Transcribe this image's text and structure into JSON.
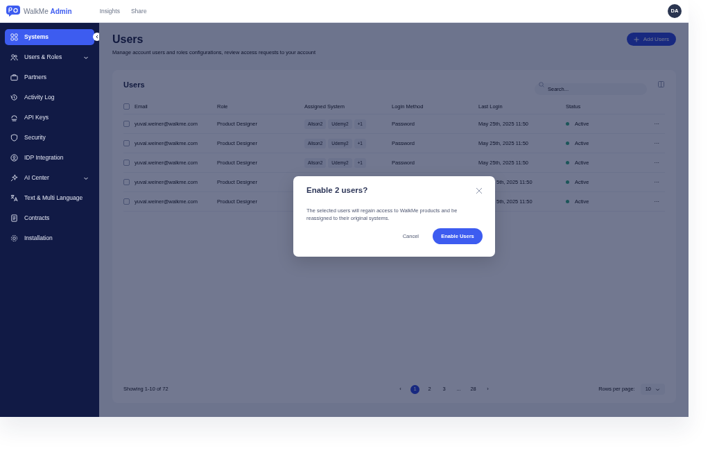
{
  "header": {
    "logo_name": "WalkMe",
    "logo_product": "Admin",
    "nav": [
      {
        "label": "Insights"
      },
      {
        "label": "Share"
      }
    ],
    "avatar": "DA"
  },
  "sidebar": {
    "items": [
      {
        "label": "Systems",
        "selected": true,
        "expandable": false
      },
      {
        "label": "Users & Roles",
        "selected": false,
        "expandable": true
      },
      {
        "label": "Partners",
        "selected": false,
        "expandable": false
      },
      {
        "label": "Activity Log",
        "selected": false,
        "expandable": false
      },
      {
        "label": "API Keys",
        "selected": false,
        "expandable": false
      },
      {
        "label": "Security",
        "selected": false,
        "expandable": false
      },
      {
        "label": "IDP Integration",
        "selected": false,
        "expandable": false
      },
      {
        "label": "AI Center",
        "selected": false,
        "expandable": true
      },
      {
        "label": "Text & Multi Language",
        "selected": false,
        "expandable": false
      },
      {
        "label": "Contracts",
        "selected": false,
        "expandable": false
      },
      {
        "label": "Installation",
        "selected": false,
        "expandable": false
      }
    ]
  },
  "page": {
    "title": "Users",
    "subtitle": "Manage account users and roles configurations, review access requests to your account",
    "add_button": "Add Users"
  },
  "users_card": {
    "title": "Users",
    "search": {
      "placeholder": "Search..."
    },
    "select_all_checked": false,
    "columns": [
      "Email",
      "Role",
      "Assigned System",
      "Login Method",
      "Last Login",
      "Status"
    ],
    "rows": [
      {
        "checked": false,
        "email": "yuval.weiner@walkme.com",
        "role": "Product Designer",
        "systems": [
          "Alison2",
          "Udemy2",
          "+1"
        ],
        "login_method": "Password",
        "last_login": "May 25th, 2025 11:50",
        "status": "Active",
        "more": "···"
      },
      {
        "checked": false,
        "email": "yuval.weiner@walkme.com",
        "role": "Product Designer",
        "systems": [
          "Alison2",
          "Udemy2",
          "+1"
        ],
        "login_method": "Password",
        "last_login": "May 25th, 2025 11:50",
        "status": "Active",
        "more": "···"
      },
      {
        "checked": false,
        "email": "yuval.weiner@walkme.com",
        "role": "Product Designer",
        "systems": [
          "Alison2",
          "Udemy2",
          "+1"
        ],
        "login_method": "Password",
        "last_login": "May 25th, 2025 11:50",
        "status": "Active",
        "more": "···"
      },
      {
        "checked": false,
        "email": "yuval.weiner@walkme.com",
        "role": "Product Designer",
        "last_login_partial": "5th, 2025 11:50",
        "status": "Active",
        "more": "···"
      },
      {
        "checked": false,
        "email": "yuval.weiner@walkme.com",
        "role": "Product Designer",
        "last_login_partial": "5th, 2025 11:50",
        "status": "Active",
        "more": "···"
      }
    ],
    "footer": {
      "showing": "Showing 1-10 of 72",
      "prev": "‹",
      "next": "›",
      "pages": [
        {
          "label": "1",
          "selected": true
        },
        {
          "label": "2",
          "selected": false
        },
        {
          "label": "3",
          "selected": false
        },
        {
          "label": "...",
          "selected": false
        },
        {
          "label": "28",
          "selected": false
        }
      ],
      "rows_per_page_label": "Rows per page:",
      "rows_per_page": "10"
    }
  },
  "modal": {
    "title": "Enable 2 users?",
    "body": "The selected users will regain access to WalkMe products and be reassigned to their original systems.",
    "cancel": "Cancel",
    "confirm": "Enable Users"
  }
}
